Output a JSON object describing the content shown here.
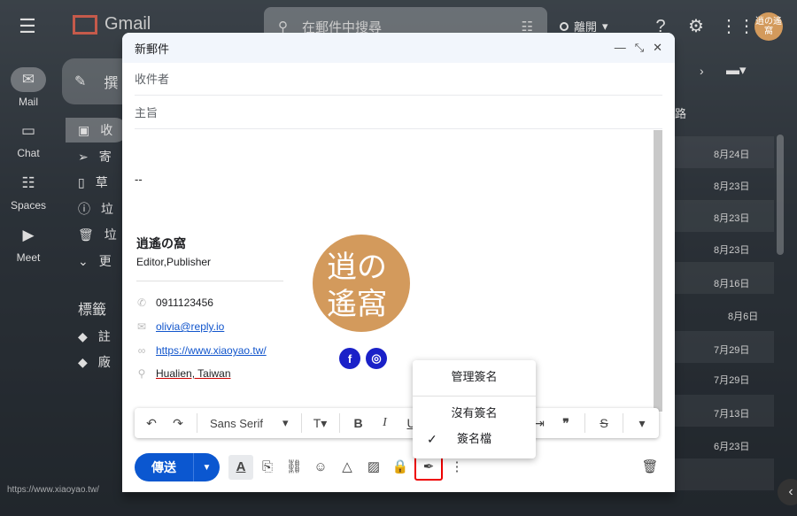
{
  "gmail": {
    "logo_text": "Gmail",
    "search_placeholder": "在郵件中搜尋",
    "status": "離開",
    "avatar_text": "逍の遙窩"
  },
  "rail": [
    {
      "label": "Mail"
    },
    {
      "label": "Chat"
    },
    {
      "label": "Spaces"
    },
    {
      "label": "Meet"
    }
  ],
  "sidebar": {
    "compose_label": "撰",
    "items": [
      "收",
      "寄",
      "草",
      "垃",
      "垃",
      "更"
    ],
    "labels_title": "標籤",
    "label_items": [
      "註",
      "廠"
    ]
  },
  "inbox": {
    "header_fragment": "路",
    "dates": [
      "8月24日",
      "8月23日",
      "8月23日",
      "8月23日",
      "8月16日",
      "8月6日",
      "7月29日",
      "7月29日",
      "7月13日",
      "6月23日"
    ]
  },
  "compose": {
    "title": "新郵件",
    "to_placeholder": "收件者",
    "subject_placeholder": "主旨",
    "signature": {
      "dash": "--",
      "name": "逍遙の窩",
      "role": "Editor,Publisher",
      "phone": "0911123456",
      "email": "olivia@reply.io",
      "website": "https://www.xiaoyao.tw/",
      "location": "Hualien, Taiwan",
      "logo_text": "逍の遙窩"
    },
    "toolbar": {
      "font": "Sans Serif"
    },
    "send_label": "傳送"
  },
  "signature_menu": {
    "manage": "管理簽名",
    "none": "沒有簽名",
    "selected": "簽名檔"
  },
  "watermark": "https://www.xiaoyao.tw/"
}
